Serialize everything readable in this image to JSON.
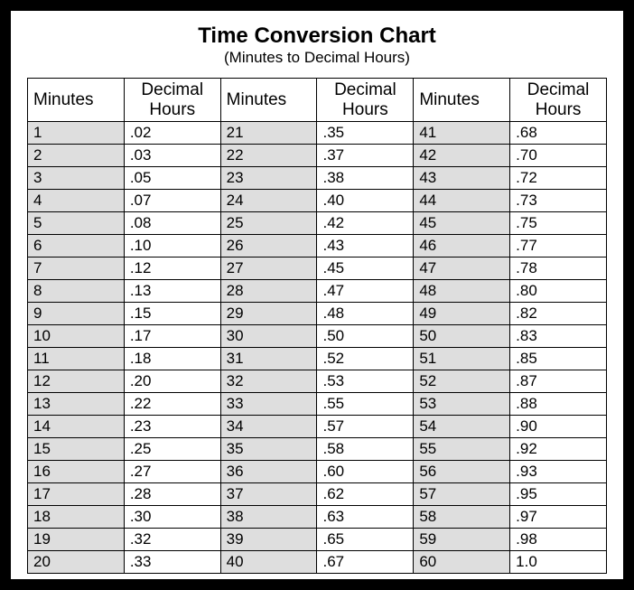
{
  "title": "Time Conversion Chart",
  "subtitle": "(Minutes to Decimal Hours)",
  "headers": {
    "minutes": "Minutes",
    "decimal": "Decimal\nHours"
  },
  "chart_data": {
    "type": "table",
    "title": "Time Conversion Chart (Minutes to Decimal Hours)",
    "columns": [
      "Minutes",
      "Decimal Hours"
    ],
    "rows": [
      [
        1,
        ".02"
      ],
      [
        2,
        ".03"
      ],
      [
        3,
        ".05"
      ],
      [
        4,
        ".07"
      ],
      [
        5,
        ".08"
      ],
      [
        6,
        ".10"
      ],
      [
        7,
        ".12"
      ],
      [
        8,
        ".13"
      ],
      [
        9,
        ".15"
      ],
      [
        10,
        ".17"
      ],
      [
        11,
        ".18"
      ],
      [
        12,
        ".20"
      ],
      [
        13,
        ".22"
      ],
      [
        14,
        ".23"
      ],
      [
        15,
        ".25"
      ],
      [
        16,
        ".27"
      ],
      [
        17,
        ".28"
      ],
      [
        18,
        ".30"
      ],
      [
        19,
        ".32"
      ],
      [
        20,
        ".33"
      ],
      [
        21,
        ".35"
      ],
      [
        22,
        ".37"
      ],
      [
        23,
        ".38"
      ],
      [
        24,
        ".40"
      ],
      [
        25,
        ".42"
      ],
      [
        26,
        ".43"
      ],
      [
        27,
        ".45"
      ],
      [
        28,
        ".47"
      ],
      [
        29,
        ".48"
      ],
      [
        30,
        ".50"
      ],
      [
        31,
        ".52"
      ],
      [
        32,
        ".53"
      ],
      [
        33,
        ".55"
      ],
      [
        34,
        ".57"
      ],
      [
        35,
        ".58"
      ],
      [
        36,
        ".60"
      ],
      [
        37,
        ".62"
      ],
      [
        38,
        ".63"
      ],
      [
        39,
        ".65"
      ],
      [
        40,
        ".67"
      ],
      [
        41,
        ".68"
      ],
      [
        42,
        ".70"
      ],
      [
        43,
        ".72"
      ],
      [
        44,
        ".73"
      ],
      [
        45,
        ".75"
      ],
      [
        46,
        ".77"
      ],
      [
        47,
        ".78"
      ],
      [
        48,
        ".80"
      ],
      [
        49,
        ".82"
      ],
      [
        50,
        ".83"
      ],
      [
        51,
        ".85"
      ],
      [
        52,
        ".87"
      ],
      [
        53,
        ".88"
      ],
      [
        54,
        ".90"
      ],
      [
        55,
        ".92"
      ],
      [
        56,
        ".93"
      ],
      [
        57,
        ".95"
      ],
      [
        58,
        ".97"
      ],
      [
        59,
        ".98"
      ],
      [
        60,
        "1.0"
      ]
    ]
  }
}
